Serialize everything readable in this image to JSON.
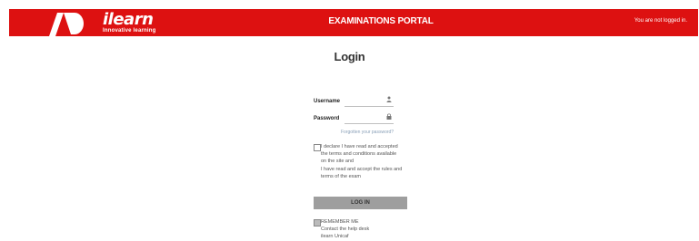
{
  "header": {
    "logo_word": "ilearn",
    "logo_tagline": "Innovative learning",
    "title": "EXAMINATIONS PORTAL",
    "login_status": "You are not logged in."
  },
  "login": {
    "heading": "Login",
    "username_label": "Username",
    "username_value": "",
    "password_label": "Password",
    "password_value": "",
    "forgot_link": "Forgotten your password?",
    "agree_lines": [
      "I declare I have read and accepted",
      "the terms and conditions available",
      "on the site and",
      "I have read and accept the rules and",
      "terms of the exam"
    ],
    "login_button": "LOG IN",
    "remember_lines": [
      "REMEMBER ME",
      "Contact the help desk",
      "ilearn Unicaf"
    ]
  },
  "colors": {
    "brand_red": "#dd1111",
    "button_gray": "#9e9e9e"
  },
  "icons": {
    "username": "user-icon",
    "password": "lock-icon"
  }
}
